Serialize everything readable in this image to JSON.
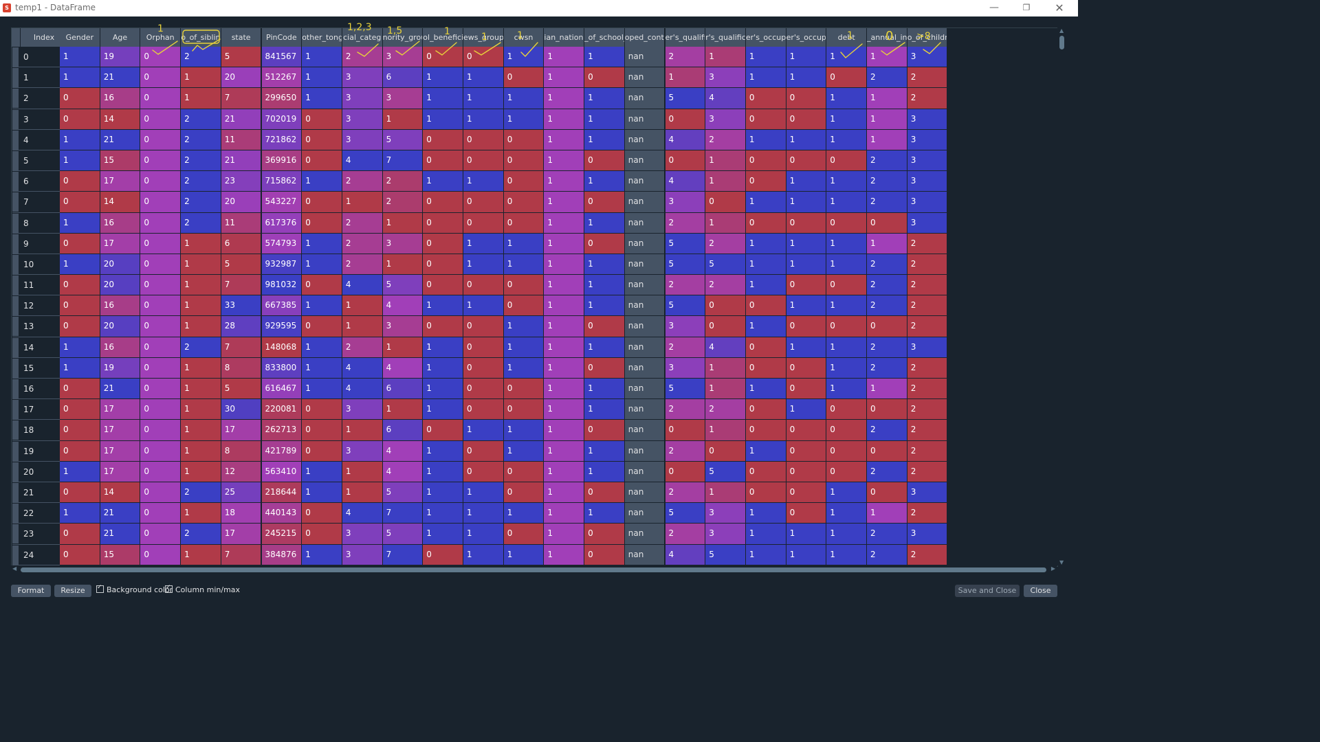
{
  "window": {
    "title": "temp1 - DataFrame",
    "minimize_icon": "—",
    "maximize_icon": "❐",
    "close_icon": "✕"
  },
  "table": {
    "index_header": "Index",
    "columns": [
      "Gender",
      "Age",
      "Orphan",
      "o_of_siblin",
      "state",
      "PinCode",
      "other_tong",
      "cial_categ",
      "nority_grou",
      "ol_beneficia",
      "ews_group",
      "cwsn",
      "ian_nationa",
      "_of_school_",
      "oped_contir",
      "er's_qualific",
      "r's_qualific",
      "er's_occup",
      "er's_occupa",
      "debt",
      "_annual_in",
      "o_of_childre"
    ],
    "rows": [
      {
        "index": "0",
        "values": [
          "1",
          "19",
          "0",
          "2",
          "5",
          "841567",
          "1",
          "2",
          "3",
          "0",
          "0",
          "1",
          "1",
          "1",
          "nan",
          "2",
          "1",
          "1",
          "1",
          "1",
          "1",
          "3"
        ]
      },
      {
        "index": "1",
        "values": [
          "1",
          "21",
          "0",
          "1",
          "20",
          "512267",
          "1",
          "3",
          "6",
          "1",
          "1",
          "0",
          "1",
          "0",
          "nan",
          "1",
          "3",
          "1",
          "1",
          "0",
          "2",
          "2"
        ]
      },
      {
        "index": "2",
        "values": [
          "0",
          "16",
          "0",
          "1",
          "7",
          "299650",
          "1",
          "3",
          "3",
          "1",
          "1",
          "1",
          "1",
          "1",
          "nan",
          "5",
          "4",
          "0",
          "0",
          "1",
          "1",
          "2"
        ]
      },
      {
        "index": "3",
        "values": [
          "0",
          "14",
          "0",
          "2",
          "21",
          "702019",
          "0",
          "3",
          "1",
          "1",
          "1",
          "1",
          "1",
          "1",
          "nan",
          "0",
          "3",
          "0",
          "0",
          "1",
          "1",
          "3"
        ]
      },
      {
        "index": "4",
        "values": [
          "1",
          "21",
          "0",
          "2",
          "11",
          "721862",
          "0",
          "3",
          "5",
          "0",
          "0",
          "0",
          "1",
          "1",
          "nan",
          "4",
          "2",
          "1",
          "1",
          "1",
          "1",
          "3"
        ]
      },
      {
        "index": "5",
        "values": [
          "1",
          "15",
          "0",
          "2",
          "21",
          "369916",
          "0",
          "4",
          "7",
          "0",
          "0",
          "0",
          "1",
          "0",
          "nan",
          "0",
          "1",
          "0",
          "0",
          "0",
          "2",
          "3"
        ]
      },
      {
        "index": "6",
        "values": [
          "0",
          "17",
          "0",
          "2",
          "23",
          "715862",
          "1",
          "2",
          "2",
          "1",
          "1",
          "0",
          "1",
          "1",
          "nan",
          "4",
          "1",
          "0",
          "1",
          "1",
          "2",
          "3"
        ]
      },
      {
        "index": "7",
        "values": [
          "0",
          "14",
          "0",
          "2",
          "20",
          "543227",
          "0",
          "1",
          "2",
          "0",
          "0",
          "0",
          "1",
          "0",
          "nan",
          "3",
          "0",
          "1",
          "1",
          "1",
          "2",
          "3"
        ]
      },
      {
        "index": "8",
        "values": [
          "1",
          "16",
          "0",
          "2",
          "11",
          "617376",
          "0",
          "2",
          "1",
          "0",
          "0",
          "0",
          "1",
          "1",
          "nan",
          "2",
          "1",
          "0",
          "0",
          "0",
          "0",
          "3"
        ]
      },
      {
        "index": "9",
        "values": [
          "0",
          "17",
          "0",
          "1",
          "6",
          "574793",
          "1",
          "2",
          "3",
          "0",
          "1",
          "1",
          "1",
          "0",
          "nan",
          "5",
          "2",
          "1",
          "1",
          "1",
          "1",
          "2"
        ]
      },
      {
        "index": "10",
        "values": [
          "1",
          "20",
          "0",
          "1",
          "5",
          "932987",
          "1",
          "2",
          "1",
          "0",
          "1",
          "1",
          "1",
          "1",
          "nan",
          "5",
          "5",
          "1",
          "1",
          "1",
          "2",
          "2"
        ]
      },
      {
        "index": "11",
        "values": [
          "0",
          "20",
          "0",
          "1",
          "7",
          "981032",
          "0",
          "4",
          "5",
          "0",
          "0",
          "0",
          "1",
          "1",
          "nan",
          "2",
          "2",
          "1",
          "0",
          "0",
          "2",
          "2"
        ]
      },
      {
        "index": "12",
        "values": [
          "0",
          "16",
          "0",
          "1",
          "33",
          "667385",
          "1",
          "1",
          "4",
          "1",
          "1",
          "0",
          "1",
          "1",
          "nan",
          "5",
          "0",
          "0",
          "1",
          "1",
          "2",
          "2"
        ]
      },
      {
        "index": "13",
        "values": [
          "0",
          "20",
          "0",
          "1",
          "28",
          "929595",
          "0",
          "1",
          "3",
          "0",
          "0",
          "1",
          "1",
          "0",
          "nan",
          "3",
          "0",
          "1",
          "0",
          "0",
          "0",
          "2"
        ]
      },
      {
        "index": "14",
        "values": [
          "1",
          "16",
          "0",
          "2",
          "7",
          "148068",
          "1",
          "2",
          "1",
          "1",
          "0",
          "1",
          "1",
          "1",
          "nan",
          "2",
          "4",
          "0",
          "1",
          "1",
          "2",
          "3"
        ]
      },
      {
        "index": "15",
        "values": [
          "1",
          "19",
          "0",
          "1",
          "8",
          "833800",
          "1",
          "4",
          "4",
          "1",
          "0",
          "1",
          "1",
          "0",
          "nan",
          "3",
          "1",
          "0",
          "0",
          "1",
          "2",
          "2"
        ]
      },
      {
        "index": "16",
        "values": [
          "0",
          "21",
          "0",
          "1",
          "5",
          "616467",
          "1",
          "4",
          "6",
          "1",
          "0",
          "0",
          "1",
          "1",
          "nan",
          "5",
          "1",
          "1",
          "0",
          "1",
          "1",
          "2"
        ]
      },
      {
        "index": "17",
        "values": [
          "0",
          "17",
          "0",
          "1",
          "30",
          "220081",
          "0",
          "3",
          "1",
          "1",
          "0",
          "0",
          "1",
          "1",
          "nan",
          "2",
          "2",
          "0",
          "1",
          "0",
          "0",
          "2"
        ]
      },
      {
        "index": "18",
        "values": [
          "0",
          "17",
          "0",
          "1",
          "17",
          "262713",
          "0",
          "1",
          "6",
          "0",
          "1",
          "1",
          "1",
          "0",
          "nan",
          "0",
          "1",
          "0",
          "0",
          "0",
          "2",
          "2"
        ]
      },
      {
        "index": "19",
        "values": [
          "0",
          "17",
          "0",
          "1",
          "8",
          "421789",
          "0",
          "3",
          "4",
          "1",
          "0",
          "1",
          "1",
          "1",
          "nan",
          "2",
          "0",
          "1",
          "0",
          "0",
          "0",
          "2"
        ]
      },
      {
        "index": "20",
        "values": [
          "1",
          "17",
          "0",
          "1",
          "12",
          "563410",
          "1",
          "1",
          "4",
          "1",
          "0",
          "0",
          "1",
          "1",
          "nan",
          "0",
          "5",
          "0",
          "0",
          "0",
          "2",
          "2"
        ]
      },
      {
        "index": "21",
        "values": [
          "0",
          "14",
          "0",
          "2",
          "25",
          "218644",
          "1",
          "1",
          "5",
          "1",
          "1",
          "0",
          "1",
          "0",
          "nan",
          "2",
          "1",
          "0",
          "0",
          "1",
          "0",
          "3"
        ]
      },
      {
        "index": "22",
        "values": [
          "1",
          "21",
          "0",
          "1",
          "18",
          "440143",
          "0",
          "4",
          "7",
          "1",
          "1",
          "1",
          "1",
          "1",
          "nan",
          "5",
          "3",
          "1",
          "0",
          "1",
          "1",
          "2"
        ]
      },
      {
        "index": "23",
        "values": [
          "0",
          "21",
          "0",
          "2",
          "17",
          "245215",
          "0",
          "3",
          "5",
          "1",
          "1",
          "0",
          "1",
          "0",
          "nan",
          "2",
          "3",
          "1",
          "1",
          "1",
          "2",
          "3"
        ]
      },
      {
        "index": "24",
        "values": [
          "0",
          "15",
          "0",
          "1",
          "7",
          "384876",
          "1",
          "3",
          "7",
          "0",
          "1",
          "1",
          "1",
          "0",
          "nan",
          "4",
          "5",
          "1",
          "1",
          "1",
          "2",
          "2"
        ]
      }
    ]
  },
  "colormap": {
    "low": "#b03a48",
    "mid": "#a13fb8",
    "high": "#3a3fc4"
  },
  "annotations": {
    "labels": [
      "1",
      "1,2,3",
      "1,5",
      "1",
      "1",
      "1",
      "1",
      "0",
      ">8"
    ]
  },
  "bottom": {
    "format_label": "Format",
    "resize_label": "Resize",
    "bg_color_label": "Background color",
    "col_minmax_label": "Column min/max",
    "save_close_label": "Save and Close",
    "close_label": "Close"
  }
}
